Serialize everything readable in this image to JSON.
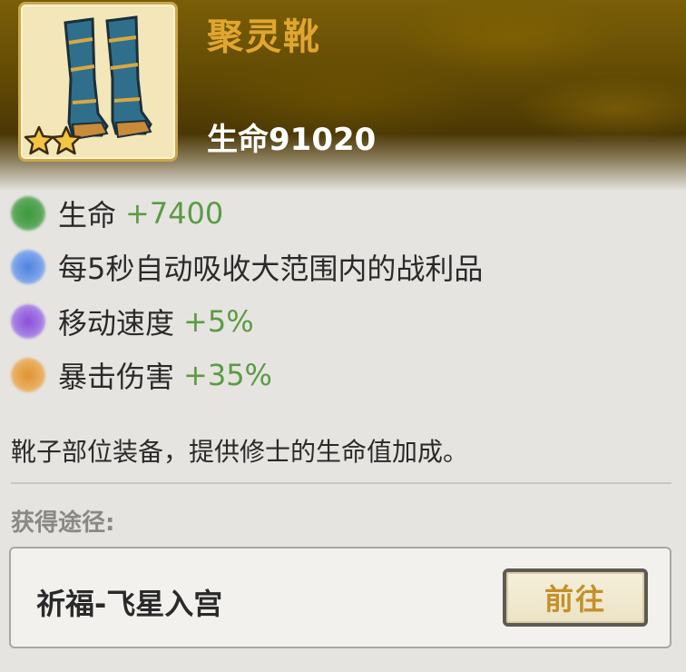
{
  "item": {
    "name": "聚灵靴",
    "main_stat_label": "生命",
    "main_stat_value": "91020",
    "stars": 2
  },
  "attributes": [
    {
      "name": "生命",
      "bonus": "+7400",
      "orb_color": "#4f9e4c"
    },
    {
      "name": "每5秒自动吸收大范围内的战利品",
      "bonus": "",
      "orb_color": "#6a96e6"
    },
    {
      "name": "移动速度",
      "bonus": "+5%",
      "orb_color": "#9767de"
    },
    {
      "name": "暴击伤害",
      "bonus": "+35%",
      "orb_color": "#e4a04a"
    }
  ],
  "description": "靴子部位装备，提供修士的生命值加成。",
  "source": {
    "label": "获得途径:",
    "name": "祈福-飞星入宫",
    "button_label": "前往"
  },
  "colors": {
    "item_name": "#e0a630",
    "bonus": "#5a9b44",
    "button_text": "#c3902a"
  }
}
